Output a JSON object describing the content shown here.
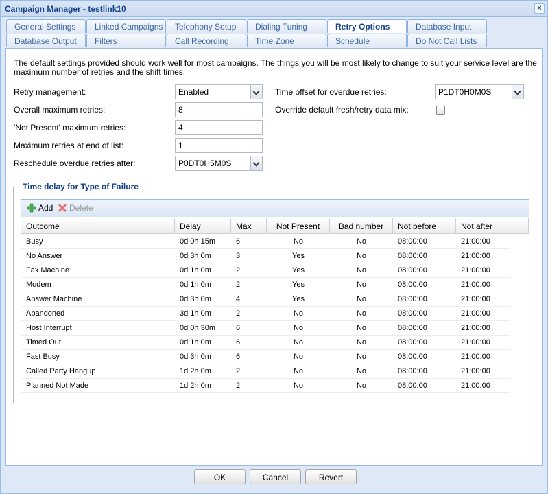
{
  "window": {
    "title": "Campaign Manager - testlink10"
  },
  "tabs": {
    "row1": [
      "General Settings",
      "Linked Campaigns",
      "Telephony Setup",
      "Dialing Tuning",
      "Retry Options",
      "Database Input"
    ],
    "row2": [
      "Database Output",
      "Filters",
      "Call Recording",
      "Time Zone",
      "Schedule",
      "Do Not Call Lists"
    ],
    "active": "Retry Options"
  },
  "intro": "The default settings provided should work well for most campaigns. The things you will be most likely to change to suit your service level are the maximum number of retries and the shift times.",
  "form": {
    "retry_management": {
      "label": "Retry management:",
      "value": "Enabled"
    },
    "overall_max": {
      "label": "Overall maximum retries:",
      "value": "8"
    },
    "not_present_max": {
      "label": "'Not Present' maximum retries:",
      "value": "4"
    },
    "end_of_list_max": {
      "label": "Maximum retries at end of list:",
      "value": "1"
    },
    "reschedule_after": {
      "label": "Reschedule overdue retries after:",
      "value": "P0DT0H5M0S"
    },
    "time_offset": {
      "label": "Time offset for overdue retries:",
      "value": "P1DT0H0M0S"
    },
    "override_mix": {
      "label": "Override default fresh/retry data mix:",
      "checked": false
    }
  },
  "failure_section": {
    "legend": "Time delay for Type of Failure",
    "toolbar": {
      "add": "Add",
      "delete": "Delete"
    },
    "columns": [
      "Outcome",
      "Delay",
      "Max",
      "Not Present",
      "Bad number",
      "Not before",
      "Not after"
    ],
    "rows": [
      [
        "Busy",
        "0d 0h 15m",
        "6",
        "No",
        "No",
        "08:00:00",
        "21:00:00"
      ],
      [
        "No Answer",
        "0d 3h 0m",
        "3",
        "Yes",
        "No",
        "08:00:00",
        "21:00:00"
      ],
      [
        "Fax Machine",
        "0d 1h 0m",
        "2",
        "Yes",
        "No",
        "08:00:00",
        "21:00:00"
      ],
      [
        "Modem",
        "0d 1h 0m",
        "2",
        "Yes",
        "No",
        "08:00:00",
        "21:00:00"
      ],
      [
        "Answer Machine",
        "0d 3h 0m",
        "4",
        "Yes",
        "No",
        "08:00:00",
        "21:00:00"
      ],
      [
        "Abandoned",
        "3d 1h 0m",
        "2",
        "No",
        "No",
        "08:00:00",
        "21:00:00"
      ],
      [
        "Host Interrupt",
        "0d 0h 30m",
        "6",
        "No",
        "No",
        "08:00:00",
        "21:00:00"
      ],
      [
        "Timed Out",
        "0d 1h 0m",
        "6",
        "No",
        "No",
        "08:00:00",
        "21:00:00"
      ],
      [
        "Fast Busy",
        "0d 3h 0m",
        "6",
        "No",
        "No",
        "08:00:00",
        "21:00:00"
      ],
      [
        "Called Party Hangup",
        "1d 2h 0m",
        "2",
        "No",
        "No",
        "08:00:00",
        "21:00:00"
      ],
      [
        "Planned Not Made",
        "1d 2h 0m",
        "2",
        "No",
        "No",
        "08:00:00",
        "21:00:00"
      ]
    ]
  },
  "buttons": {
    "ok": "OK",
    "cancel": "Cancel",
    "revert": "Revert"
  },
  "colors": {
    "accent": "#15428b",
    "border": "#99bbe8",
    "panel": "#dfe8f6"
  }
}
